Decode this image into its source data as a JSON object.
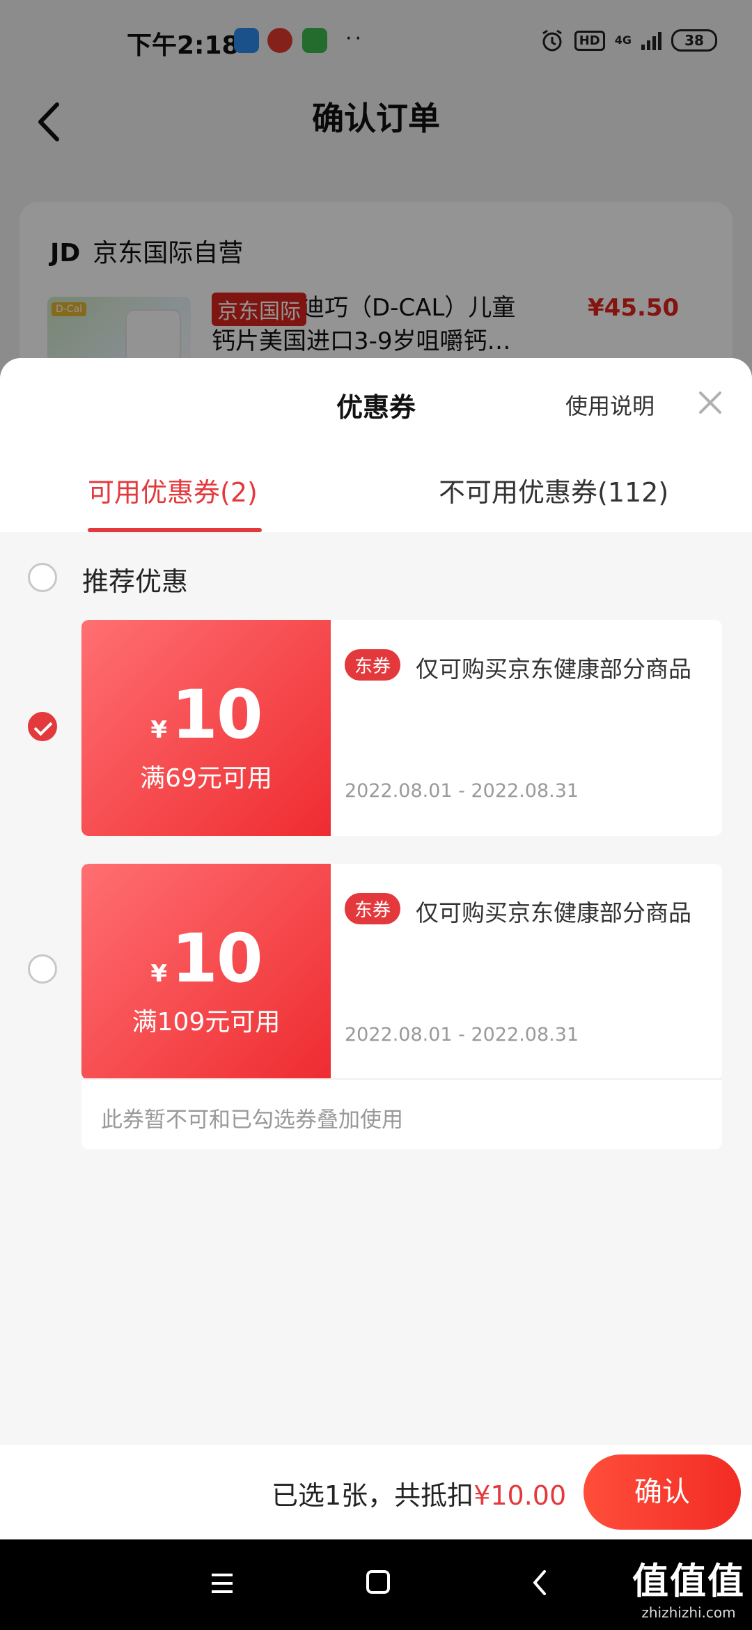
{
  "status_bar": {
    "time": "下午2:18",
    "dots": "··",
    "network": "4G",
    "hd": "HD",
    "battery": "38"
  },
  "background_page": {
    "title": "确认订单",
    "store": {
      "logo_text": "JD",
      "name": "京东国际自营"
    },
    "product": {
      "tag": "京东国际",
      "title": "迪巧（D-CAL）儿童钙片美国进口3-9岁咀嚼钙…",
      "price": "¥45.50",
      "image_badge": "D-Cal"
    }
  },
  "sheet": {
    "title": "优惠券",
    "usage_link": "使用说明",
    "tabs": [
      {
        "label": "可用优惠券(2)",
        "active": true
      },
      {
        "label": "不可用优惠券(112)",
        "active": false
      }
    ],
    "recommend_label": "推荐优惠",
    "coupons": [
      {
        "currency": "¥",
        "amount": "10",
        "condition": "满69元可用",
        "tag": "东券",
        "description": "仅可购买京东健康部分商品",
        "date_range": "2022.08.01 - 2022.08.31",
        "selected": true
      },
      {
        "currency": "¥",
        "amount": "10",
        "condition": "满109元可用",
        "tag": "东券",
        "description": "仅可购买京东健康部分商品",
        "date_range": "2022.08.01 - 2022.08.31",
        "selected": false,
        "note": "此券暂不可和已勾选券叠加使用"
      }
    ]
  },
  "footer": {
    "selected_prefix": "已选1张，共抵扣",
    "selected_amount": "¥10.00",
    "confirm_label": "确认"
  },
  "watermark": {
    "main": "值值值",
    "sub": "zhizhizhi.com"
  },
  "colors": {
    "accent": "#e4393c",
    "coupon_gradient_start": "#ff6f72",
    "coupon_gradient_end": "#ee2c30"
  },
  "icons": [
    "back-arrow-icon",
    "close-icon",
    "alarm-icon",
    "signal-icon",
    "battery-icon",
    "checkmark-icon",
    "menu-icon",
    "home-icon",
    "back-icon"
  ]
}
